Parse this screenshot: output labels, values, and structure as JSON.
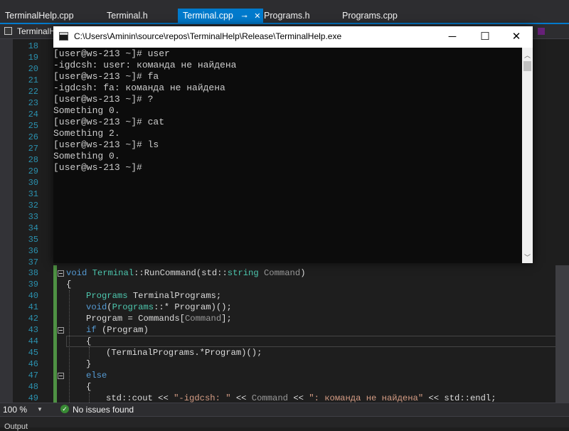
{
  "tabs": [
    {
      "label": "TerminalHelp.cpp",
      "active": false
    },
    {
      "label": "Terminal.h",
      "active": false
    },
    {
      "label": "Terminal.cpp",
      "active": true
    },
    {
      "label": "Programs.h",
      "active": false
    },
    {
      "label": "Programs.cpp",
      "active": false
    }
  ],
  "nav": {
    "project_label": "TerminalH"
  },
  "console": {
    "title": "C:\\Users\\Aminin\\source\\repos\\TerminalHelp\\Release\\TerminalHelp.exe",
    "minimize_glyph": "─",
    "maximize_glyph": "☐",
    "close_glyph": "✕",
    "lines": [
      "[user@ws-213 ~]# user",
      "-igdcsh: user: команда не найдена",
      "[user@ws-213 ~]# fa",
      "-igdcsh: fa: команда не найдена",
      "[user@ws-213 ~]# ?",
      "Something 0.",
      "[user@ws-213 ~]# cat",
      "Something 2.",
      "[user@ws-213 ~]# ls",
      "Something 0.",
      "[user@ws-213 ~]#"
    ]
  },
  "editor": {
    "line_numbers": [
      "18",
      "19",
      "20",
      "21",
      "22",
      "23",
      "24",
      "25",
      "26",
      "27",
      "28",
      "29",
      "30",
      "31",
      "32",
      "33",
      "34",
      "35",
      "36",
      "37",
      "38",
      "39",
      "40",
      "41",
      "42",
      "43",
      "44",
      "45",
      "46",
      "47",
      "48",
      "49"
    ],
    "code": {
      "l38": {
        "kw": "void",
        "ty": "Terminal",
        "sep": "::RunCommand(std::",
        "ty2": "string",
        "sp": " ",
        "pa": "Command",
        "end": ")"
      },
      "l39": "{",
      "l40": {
        "ty": "Programs",
        "rest": " TerminalPrograms;"
      },
      "l41": {
        "kw": "void",
        "a": "(",
        "ty": "Programs",
        "rest": "::* Program)();"
      },
      "l42": {
        "a": "Program = Commands[",
        "pa": "Command",
        "b": "];"
      },
      "l43": {
        "kw": "if",
        "rest": " (Program)"
      },
      "l44": "{",
      "l45": "(TerminalPrograms.*Program)();",
      "l46": "}",
      "l47": {
        "kw": "else"
      },
      "l48": "{",
      "l49": {
        "a": "std::cout << ",
        "s1": "\"-igdcsh: \"",
        "b": " << ",
        "pa": "Command",
        "c": " << ",
        "s2": "\": команда не найдена\"",
        "d": " << std::endl;"
      }
    }
  },
  "status": {
    "zoom": "100 %",
    "issues_icon_glyph": "✓",
    "issues": "No issues found"
  },
  "output": {
    "label": "Output"
  },
  "icons": {
    "check": "check-icon",
    "fold": "collapse-icon",
    "app": "console-app-icon"
  },
  "colors": {
    "accent": "#007acc",
    "keyword": "#569cd6",
    "type": "#4ec9b0",
    "parameter": "#9a9a9a",
    "string": "#d69d85",
    "line_number": "#2b91af",
    "change_bar": "#57a64a"
  }
}
